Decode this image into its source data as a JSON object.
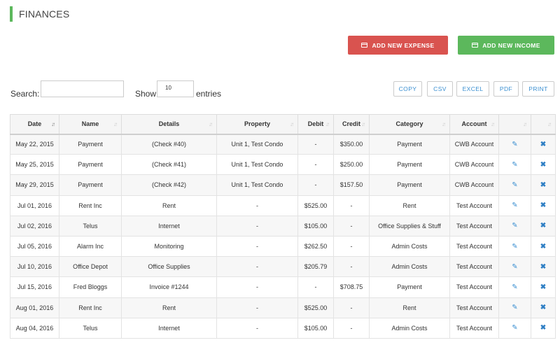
{
  "page": {
    "title": "FINANCES"
  },
  "actions": {
    "add_expense": "ADD NEW EXPENSE",
    "add_income": "ADD NEW INCOME"
  },
  "search": {
    "label": "Search:",
    "value": ""
  },
  "length": {
    "show": "Show",
    "value": "10",
    "entries": "entries"
  },
  "export": [
    "COPY",
    "CSV",
    "EXCEL",
    "PDF",
    "PRINT"
  ],
  "table": {
    "columns": [
      "Date",
      "Name",
      "Details",
      "Property",
      "Debit",
      "Credit",
      "Category",
      "Account",
      "",
      ""
    ],
    "rows": [
      {
        "date": "May 22, 2015",
        "name": "Payment",
        "details": "(Check #40)",
        "property": "Unit 1, Test Condo",
        "debit": "-",
        "credit": "$350.00",
        "category": "Payment",
        "account": "CWB Account"
      },
      {
        "date": "May 25, 2015",
        "name": "Payment",
        "details": "(Check #41)",
        "property": "Unit 1, Test Condo",
        "debit": "-",
        "credit": "$250.00",
        "category": "Payment",
        "account": "CWB Account"
      },
      {
        "date": "May 29, 2015",
        "name": "Payment",
        "details": "(Check #42)",
        "property": "Unit 1, Test Condo",
        "debit": "-",
        "credit": "$157.50",
        "category": "Payment",
        "account": "CWB Account"
      },
      {
        "date": "Jul 01, 2016",
        "name": "Rent Inc",
        "details": "Rent",
        "property": "-",
        "debit": "$525.00",
        "credit": "-",
        "category": "Rent",
        "account": "Test Account"
      },
      {
        "date": "Jul 02, 2016",
        "name": "Telus",
        "details": "Internet",
        "property": "-",
        "debit": "$105.00",
        "credit": "-",
        "category": "Office Supplies & Stuff",
        "account": "Test Account"
      },
      {
        "date": "Jul 05, 2016",
        "name": "Alarm Inc",
        "details": "Monitoring",
        "property": "-",
        "debit": "$262.50",
        "credit": "-",
        "category": "Admin Costs",
        "account": "Test Account"
      },
      {
        "date": "Jul 10, 2016",
        "name": "Office Depot",
        "details": "Office Supplies",
        "property": "-",
        "debit": "$205.79",
        "credit": "-",
        "category": "Admin Costs",
        "account": "Test Account"
      },
      {
        "date": "Jul 15, 2016",
        "name": "Fred Bloggs",
        "details": "Invoice #1244",
        "property": "-",
        "debit": "-",
        "credit": "$708.75",
        "category": "Payment",
        "account": "Test Account"
      },
      {
        "date": "Aug 01, 2016",
        "name": "Rent Inc",
        "details": "Rent",
        "property": "-",
        "debit": "$525.00",
        "credit": "-",
        "category": "Rent",
        "account": "Test Account"
      },
      {
        "date": "Aug 04, 2016",
        "name": "Telus",
        "details": "Internet",
        "property": "-",
        "debit": "$105.00",
        "credit": "-",
        "category": "Admin Costs",
        "account": "Test Account"
      }
    ]
  },
  "icons": {
    "edit": "edit-icon",
    "delete": "delete-icon",
    "card": "credit-card-icon"
  },
  "colors": {
    "accent": "#5cb85c",
    "expense": "#d9534f",
    "income": "#5cb85c",
    "debit": "#e02a2a",
    "credit": "#2c8a2c",
    "link": "#3a8fd1"
  }
}
